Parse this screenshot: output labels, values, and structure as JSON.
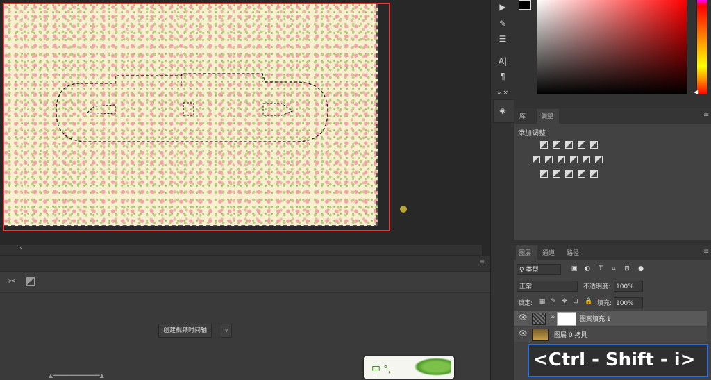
{
  "canvas": {
    "selection_style": "marching-ants",
    "frame_color": "#e53a3a",
    "scroll_arrow": "›"
  },
  "toolbar": {
    "items": [
      {
        "name": "play-icon",
        "glyph": "▶"
      },
      {
        "name": "brush-settings-icon",
        "glyph": "✎"
      },
      {
        "name": "adjust-sliders-icon",
        "glyph": "⚟"
      },
      {
        "name": "character-icon",
        "glyph": "A|"
      },
      {
        "name": "paragraph-icon",
        "glyph": "¶"
      },
      {
        "name": "libraries-icon",
        "glyph": "◈"
      }
    ],
    "panel_grip": "▸▸ ×"
  },
  "adjustments": {
    "tabs": [
      "库",
      "调整"
    ],
    "active_tab": "调整",
    "title": "添加调整",
    "rows": [
      [
        "brightness-icon",
        "levels-icon",
        "curves-icon",
        "exposure-icon",
        "vibrance-icon"
      ],
      [
        "hue-saturation-icon",
        "color-balance-icon",
        "black-white-icon",
        "photo-filter-icon",
        "channel-mixer-icon",
        "color-lookup-icon"
      ],
      [
        "invert-icon",
        "posterize-icon",
        "threshold-icon",
        "gradient-map-icon",
        "selective-color-icon"
      ]
    ]
  },
  "layers": {
    "tabs": [
      "图层",
      "通道",
      "路径"
    ],
    "active_tab": "图层",
    "filter": "♀ 类型",
    "blend_mode": "正常",
    "opacity_label": "不透明度:",
    "opacity_value": "100%",
    "lock_label": "锁定:",
    "fill_label": "填充:",
    "fill_value": "100%",
    "items": [
      {
        "name": "图案填充 1",
        "visible": true,
        "selected": true
      },
      {
        "name": "图层 0 拷贝",
        "visible": true,
        "selected": false
      }
    ]
  },
  "timeline": {
    "create_button": "创建视频时间轴",
    "dropdown_arrow": "∨"
  },
  "ime": {
    "text": "中 °,"
  },
  "overlay": {
    "shortcut": "<Ctrl - Shift - i>",
    "border_color": "#2f6fdc"
  }
}
